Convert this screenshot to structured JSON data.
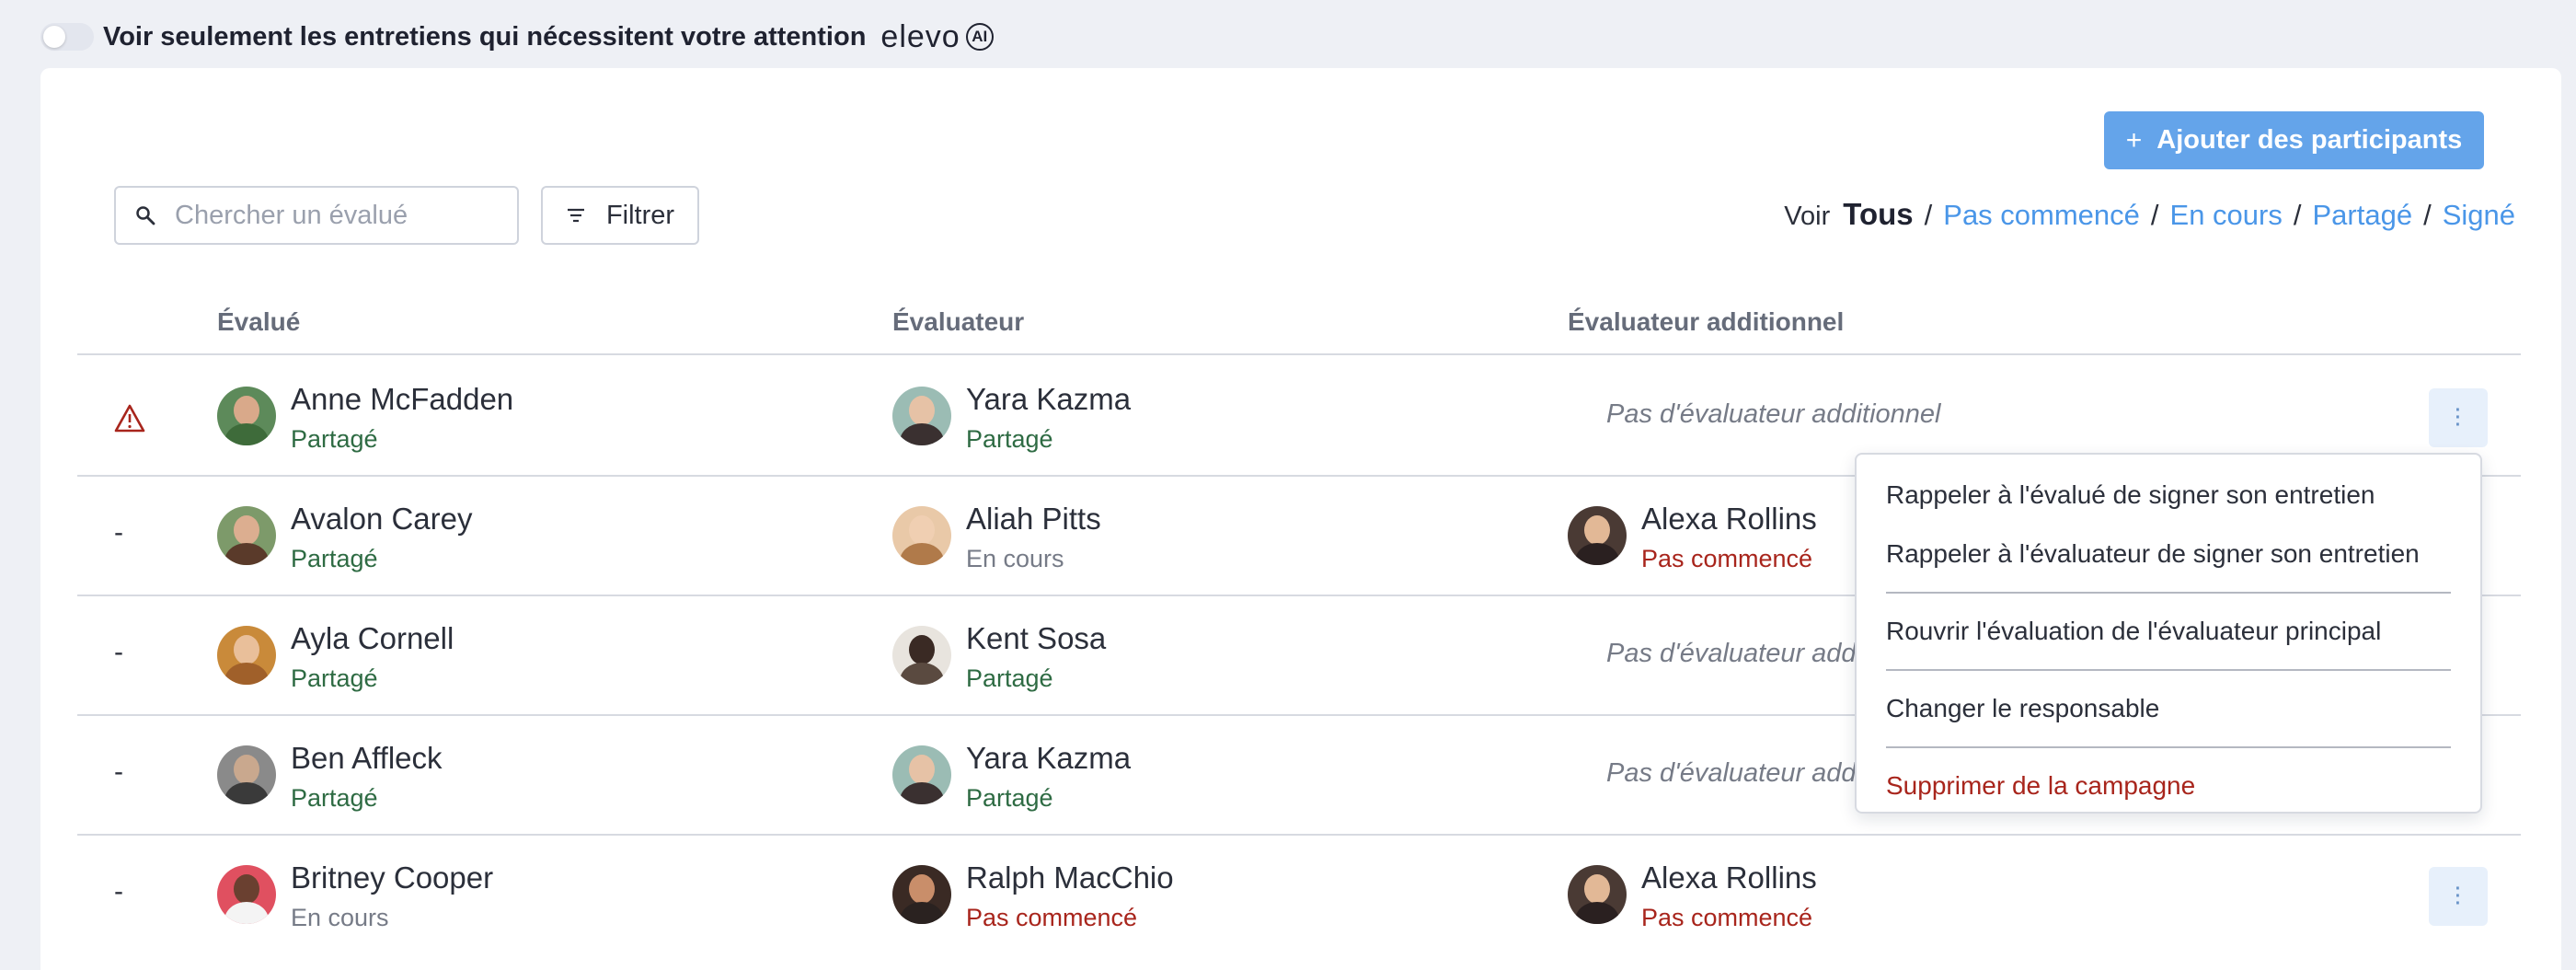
{
  "topbar": {
    "toggle_label": "Voir seulement les entretiens qui nécessitent votre attention",
    "brand": "elevo",
    "brand_badge": "AI"
  },
  "toolbar": {
    "add_label": "Ajouter des participants",
    "search_placeholder": "Chercher un évalué",
    "filter_label": "Filtrer",
    "view_prefix": "Voir",
    "view_active": "Tous",
    "view_options": [
      "Pas commencé",
      "En cours",
      "Partagé",
      "Signé"
    ],
    "separator": "/"
  },
  "table": {
    "headers": [
      "Évalué",
      "Évaluateur",
      "Évaluateur additionnel"
    ],
    "no_additional": "Pas d'évaluateur additionnel",
    "dash": "-",
    "rows": [
      {
        "flag": "warning",
        "reviewee": {
          "name": "Anne McFadden",
          "status": "Partagé"
        },
        "reviewer": {
          "name": "Yara Kazma",
          "status": "Partagé"
        },
        "additional": null
      },
      {
        "flag": "-",
        "reviewee": {
          "name": "Avalon Carey",
          "status": "Partagé"
        },
        "reviewer": {
          "name": "Aliah Pitts",
          "status": "En cours"
        },
        "additional": {
          "name": "Alexa Rollins",
          "status": "Pas commencé"
        }
      },
      {
        "flag": "-",
        "reviewee": {
          "name": "Ayla Cornell",
          "status": "Partagé"
        },
        "reviewer": {
          "name": "Kent Sosa",
          "status": "Partagé"
        },
        "additional": null
      },
      {
        "flag": "-",
        "reviewee": {
          "name": "Ben Affleck",
          "status": "Partagé"
        },
        "reviewer": {
          "name": "Yara Kazma",
          "status": "Partagé"
        },
        "additional": null
      },
      {
        "flag": "-",
        "reviewee": {
          "name": "Britney Cooper",
          "status": "En cours"
        },
        "reviewer": {
          "name": "Ralph MacChio",
          "status": "Pas commencé"
        },
        "additional": {
          "name": "Alexa Rollins",
          "status": "Pas commencé"
        }
      }
    ]
  },
  "menu": {
    "items": [
      "Rappeler à l'évalué de signer son entretien",
      "Rappeler à l'évaluateur de signer son entretien",
      "Rouvrir l'évaluation de l'évaluateur principal",
      "Changer le responsable",
      "Supprimer de la campagne"
    ]
  },
  "colors": {
    "accent": "#64a4ea",
    "link": "#4a96e8",
    "status_shared": "#2e6b43",
    "status_in_progress": "#767b87",
    "status_not_started": "#a8251c",
    "danger": "#a8251c"
  }
}
